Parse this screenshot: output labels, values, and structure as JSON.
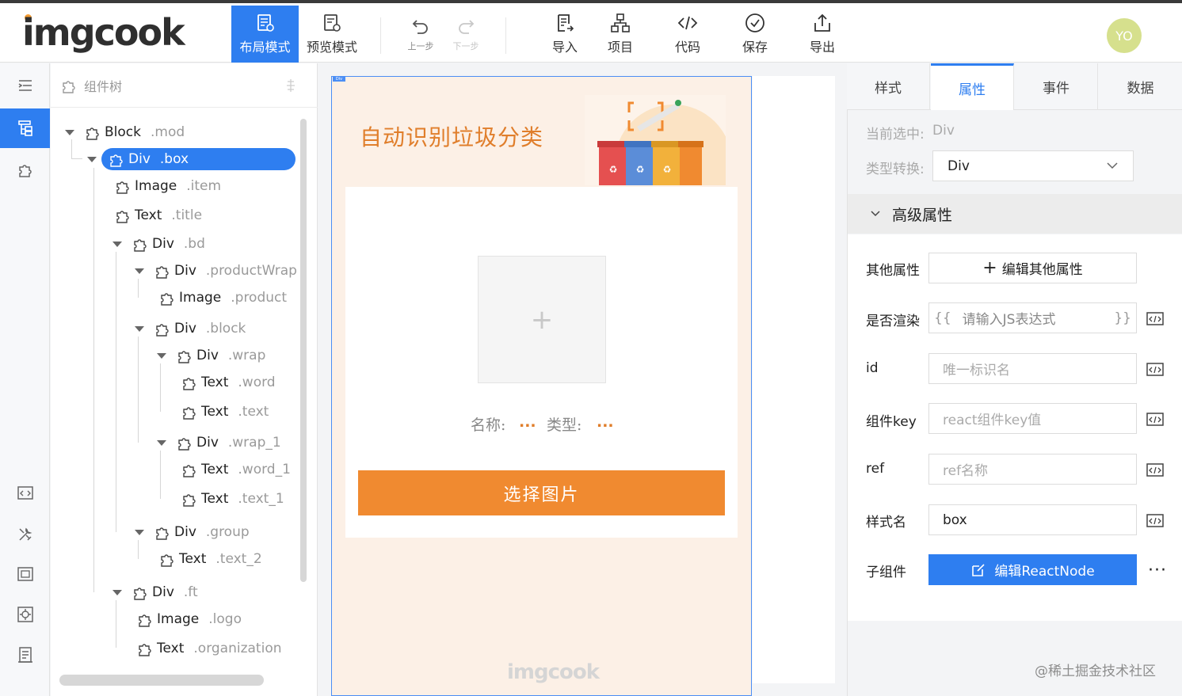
{
  "app": {
    "logo": "imgcook",
    "avatar": "YO"
  },
  "toolbar": {
    "layout_mode": "布局模式",
    "preview_mode": "预览模式",
    "undo": "上一步",
    "redo": "下一步",
    "import": "导入",
    "project": "项目",
    "code": "代码",
    "save": "保存",
    "export": "导出"
  },
  "tree": {
    "header": "组件树",
    "nodes": [
      {
        "type": "Block",
        "cls": ".mod"
      },
      {
        "type": "Div",
        "cls": ".box"
      },
      {
        "type": "Image",
        "cls": ".item"
      },
      {
        "type": "Text",
        "cls": ".title"
      },
      {
        "type": "Div",
        "cls": ".bd"
      },
      {
        "type": "Div",
        "cls": ".productWrap"
      },
      {
        "type": "Image",
        "cls": ".product"
      },
      {
        "type": "Div",
        "cls": ".block"
      },
      {
        "type": "Div",
        "cls": ".wrap"
      },
      {
        "type": "Text",
        "cls": ".word"
      },
      {
        "type": "Text",
        "cls": ".text"
      },
      {
        "type": "Div",
        "cls": ".wrap_1"
      },
      {
        "type": "Text",
        "cls": ".word_1"
      },
      {
        "type": "Text",
        "cls": ".text_1"
      },
      {
        "type": "Div",
        "cls": ".group"
      },
      {
        "type": "Text",
        "cls": ".text_2"
      },
      {
        "type": "Div",
        "cls": ".ft"
      },
      {
        "type": "Image",
        "cls": ".logo"
      },
      {
        "type": "Text",
        "cls": ".organization"
      }
    ]
  },
  "canvas": {
    "div_tag": "Div",
    "title": "自动识别垃圾分类",
    "upload_plus": "+",
    "name_label": "名称:",
    "name_value": "...",
    "type_label": "类型:",
    "type_value": "...",
    "choose_button": "选择图片",
    "footer_logo": "imgcook"
  },
  "right_panel": {
    "tabs": [
      "样式",
      "属性",
      "事件",
      "数据"
    ],
    "active_tab": "属性",
    "current_selected_label": "当前选中:",
    "current_selected_value": "Div",
    "type_convert_label": "类型转换:",
    "type_convert_value": "Div",
    "advanced_title": "高级属性",
    "rows": {
      "other_props_label": "其他属性",
      "other_props_button": "编辑其他属性",
      "render_label": "是否渲染",
      "render_open": "{{",
      "render_placeholder": "请输入JS表达式",
      "render_close": "}}",
      "id_label": "id",
      "id_placeholder": "唯一标识名",
      "key_label": "组件key",
      "key_placeholder": "react组件key值",
      "ref_label": "ref",
      "ref_placeholder": "ref名称",
      "classname_label": "样式名",
      "classname_value": "box",
      "children_label": "子组件",
      "children_button": "编辑ReactNode",
      "more": "···"
    }
  },
  "watermark": "@稀土掘金技术社区",
  "colors": {
    "accent": "#2e7ef0",
    "brand_orange": "#f08a30",
    "title_orange": "#e07e2b"
  }
}
